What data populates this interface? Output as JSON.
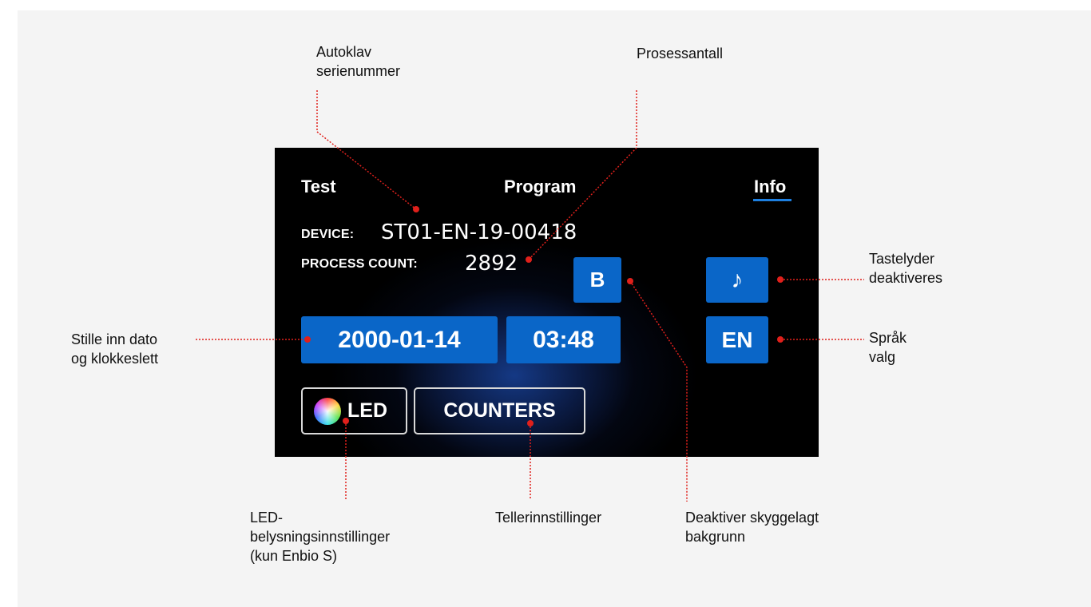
{
  "screen": {
    "tabs": {
      "test": "Test",
      "program": "Program",
      "info": "Info"
    },
    "device_label": "DEVICE:",
    "device_value": "ST01-EN-19-00418",
    "count_label": "PROCESS COUNT:",
    "count_value": "2892",
    "buttons": {
      "b": "B",
      "sound": "♪",
      "date": "2000-01-14",
      "time": "03:48",
      "lang": "EN",
      "led": "LED",
      "counters": "COUNTERS"
    },
    "colors": {
      "accent": "#0a66c8",
      "leader": "#e0201b"
    },
    "icons": {
      "sound": "music-note-icon",
      "led": "color-wheel-icon"
    }
  },
  "callouts": {
    "serial": {
      "line1": "Autoklav",
      "line2": "serienummer"
    },
    "count": {
      "line1": "Prosessantall"
    },
    "key_sounds": {
      "line1": "Tastelyder",
      "line2": "deaktiveres"
    },
    "language": {
      "line1": "Språk",
      "line2": "valg"
    },
    "datetime": {
      "line1": "Stille inn dato",
      "line2": "og klokkeslett"
    },
    "led": {
      "line1": "LED-",
      "line2": "belysningsinnstillinger",
      "line3": "(kun Enbio S)"
    },
    "counters": {
      "line1": "Tellerinnstillinger"
    },
    "background": {
      "line1": "Deaktiver skyggelagt",
      "line2": "bakgrunn"
    }
  }
}
